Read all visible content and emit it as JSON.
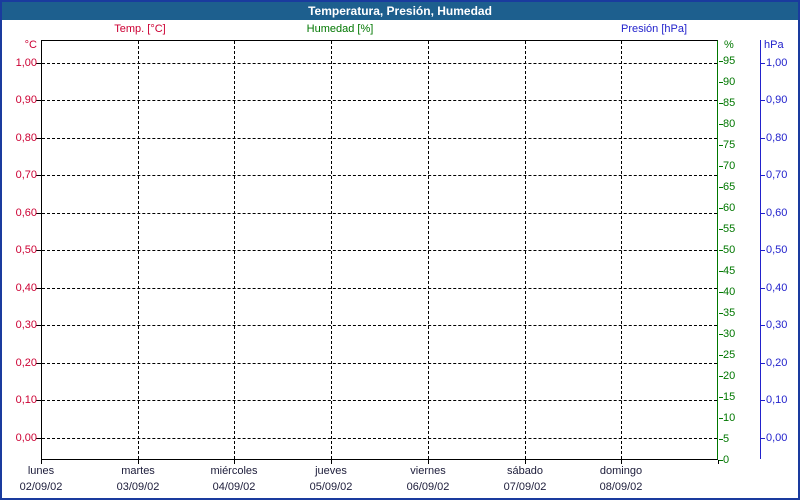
{
  "window": {
    "title": "Temperatura, Presión, Humedad"
  },
  "legend": {
    "temp": "Temp. [°C]",
    "humidity": "Humedad [%]",
    "pressure": "Presión [hPa]"
  },
  "colors": {
    "temp": "#cc0033",
    "humidity": "#007700",
    "pressure": "#2222cc",
    "titlebar_bg": "#1d5f8e",
    "titlebar_text": "#ffffff",
    "page_border": "#1a3b9e",
    "grid": "#000000",
    "footer_text": "#1c1c3a",
    "plot_bg": "#ffffff"
  },
  "chart_data": {
    "type": "line",
    "title": "Temperatura, Presión, Humedad",
    "grid": "dashed",
    "legend_position": "top",
    "series": [
      {
        "name": "Temp. [°C]",
        "axis": "celsius_left",
        "color": "#cc0033",
        "values": []
      },
      {
        "name": "Humedad [%]",
        "axis": "percent_right",
        "color": "#007700",
        "values": []
      },
      {
        "name": "Presión [hPa]",
        "axis": "hpa_right",
        "color": "#2222cc",
        "values": []
      }
    ],
    "axes": {
      "celsius_left": {
        "header": "°C",
        "min": 0,
        "max": 1,
        "step": 0.1,
        "ticks": [
          "1,00",
          "0,90",
          "0,80",
          "0,70",
          "0,60",
          "0,50",
          "0,40",
          "0,30",
          "0,20",
          "0,10",
          "0,00"
        ]
      },
      "percent_right": {
        "header": "%",
        "min": 0,
        "max": 100,
        "step": 5,
        "ticks": [
          "95",
          "90",
          "85",
          "80",
          "75",
          "70",
          "65",
          "60",
          "55",
          "50",
          "45",
          "40",
          "35",
          "30",
          "25",
          "20",
          "15",
          "10",
          "5",
          "0"
        ]
      },
      "hpa_right": {
        "header": "hPa",
        "min": 0,
        "max": 1,
        "step": 0.1,
        "ticks": [
          "1,00",
          "0,90",
          "0,80",
          "0,70",
          "0,60",
          "0,50",
          "0,40",
          "0,30",
          "0,20",
          "0,10",
          "0,00"
        ]
      }
    },
    "x_axis": {
      "days": [
        {
          "weekday": "lunes",
          "date": "02/09/02"
        },
        {
          "weekday": "martes",
          "date": "03/09/02"
        },
        {
          "weekday": "miércoles",
          "date": "04/09/02"
        },
        {
          "weekday": "jueves",
          "date": "05/09/02"
        },
        {
          "weekday": "viernes",
          "date": "06/09/02"
        },
        {
          "weekday": "sábado",
          "date": "07/09/02"
        },
        {
          "weekday": "domingo",
          "date": "08/09/02"
        }
      ]
    }
  }
}
